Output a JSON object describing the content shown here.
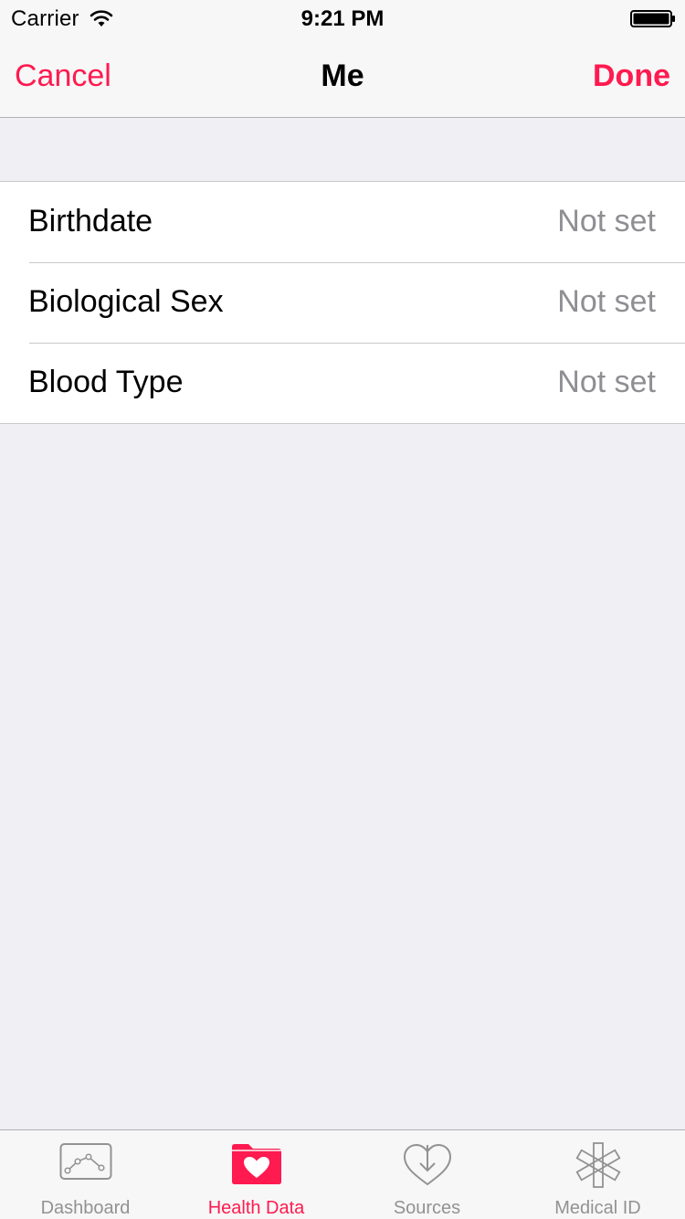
{
  "status_bar": {
    "carrier": "Carrier",
    "time": "9:21 PM",
    "icons": [
      "wifi-icon",
      "battery-icon"
    ]
  },
  "nav_bar": {
    "cancel_label": "Cancel",
    "title": "Me",
    "done_label": "Done"
  },
  "rows": [
    {
      "label": "Birthdate",
      "value": "Not set"
    },
    {
      "label": "Biological Sex",
      "value": "Not set"
    },
    {
      "label": "Blood Type",
      "value": "Not set"
    }
  ],
  "tab_bar": {
    "tabs": [
      {
        "label": "Dashboard",
        "icon": "dashboard-chart-icon",
        "active": false
      },
      {
        "label": "Health Data",
        "icon": "health-data-folder-heart-icon",
        "active": true
      },
      {
        "label": "Sources",
        "icon": "sources-heart-arrow-icon",
        "active": false
      },
      {
        "label": "Medical ID",
        "icon": "medical-star-of-life-icon",
        "active": false
      }
    ]
  },
  "colors": {
    "accent": "#ff1a4f",
    "background": "#efeff4",
    "secondary_text": "#8e8e93",
    "inactive_tab": "#929292"
  }
}
